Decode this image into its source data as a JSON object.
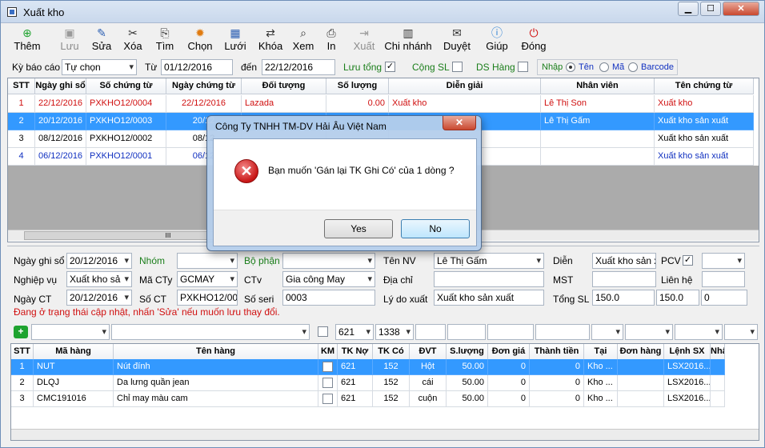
{
  "window": {
    "title": "Xuất kho",
    "min": "▁",
    "max": "☐",
    "close": "✕"
  },
  "toolbar": [
    {
      "label": "Thêm",
      "icon": "plus-icon",
      "enabled": true
    },
    {
      "label": "Lưu",
      "icon": "save-icon",
      "enabled": false
    },
    {
      "label": "Sửa",
      "icon": "edit-icon",
      "enabled": true
    },
    {
      "label": "Xóa",
      "icon": "delete-icon",
      "enabled": true
    },
    {
      "label": "Tìm",
      "icon": "find-icon",
      "enabled": true
    },
    {
      "label": "Chọn",
      "icon": "choose-icon",
      "enabled": true
    },
    {
      "label": "Lưới",
      "icon": "grid-icon",
      "enabled": true
    },
    {
      "label": "Khóa",
      "icon": "lock-icon",
      "enabled": true
    },
    {
      "label": "Xem",
      "icon": "view-icon",
      "enabled": true
    },
    {
      "label": "In",
      "icon": "print-icon",
      "enabled": true
    },
    {
      "label": "Xuất",
      "icon": "export-icon",
      "enabled": false
    },
    {
      "label": "Chi nhánh",
      "icon": "branch-icon",
      "enabled": true
    },
    {
      "label": "Duyệt",
      "icon": "approve-icon",
      "enabled": true
    },
    {
      "label": "Giúp",
      "icon": "help-icon",
      "enabled": true
    },
    {
      "label": "Đóng",
      "icon": "power-icon",
      "enabled": true
    }
  ],
  "filter": {
    "ky_bao_cao_label": "Kỳ báo cáo",
    "ky_bao_cao": "Tự chọn",
    "tu_label": "Từ",
    "tu": "01/12/2016",
    "den_label": "đến",
    "den": "22/12/2016",
    "luu_tong": "Lưu tổng",
    "cong_sl": "Cộng SL",
    "ds_hang": "DS Hàng",
    "nhap": "Nhập",
    "ten": "Tên",
    "ma": "Mã",
    "barcode": "Barcode"
  },
  "master": {
    "headers": [
      "STT",
      "Ngày ghi sổ",
      "Số chứng từ",
      "Ngày chứng từ",
      "Đối tượng",
      "Số lượng",
      "Diễn giải",
      "Nhân viên",
      "Tên chứng từ"
    ],
    "rows": [
      {
        "stt": "1",
        "ngay": "22/12/2016",
        "so": "PXKHO12/0004",
        "ngayct": "22/12/2016",
        "doi_tuong": "Lazada",
        "sl": "0.00",
        "dien_giai": "Xuất kho",
        "nv": "Lê Thị Son",
        "ten_ct": "Xuất kho"
      },
      {
        "stt": "2",
        "ngay": "20/12/2016",
        "so": "PXKHO12/0003",
        "ngayct": "20/12",
        "doi_tuong": "",
        "sl": "",
        "dien_giai": "",
        "nv": "Lê Thị Gấm",
        "ten_ct": "Xuất kho sản xuất"
      },
      {
        "stt": "3",
        "ngay": "08/12/2016",
        "so": "PXKHO12/0002",
        "ngayct": "08/12",
        "doi_tuong": "",
        "sl": "",
        "dien_giai": "",
        "nv": "",
        "ten_ct": "Xuất kho sản xuất"
      },
      {
        "stt": "4",
        "ngay": "06/12/2016",
        "so": "PXKHO12/0001",
        "ngayct": "06/12",
        "doi_tuong": "",
        "sl": "",
        "dien_giai": "",
        "nv": "",
        "ten_ct": "Xuất kho sản xuất"
      }
    ],
    "scroll": "III"
  },
  "form": {
    "ngay_ghi_so_label": "Ngày ghi sổ",
    "ngay_ghi_so": "20/12/2016",
    "nhom_label": "Nhóm",
    "bo_phan_label": "Bộ phận",
    "ten_nv_label": "Tên NV",
    "ten_nv": "Lê Thị Gấm",
    "dien_label": "Diễn",
    "dien": "Xuất kho sản xi",
    "pcv_label": "PCV",
    "nghiep_vu_label": "Nghiệp vụ",
    "nghiep_vu": "Xuất kho sả",
    "ma_cty_label": "Mã CTy",
    "ma_cty": "GCMAY",
    "ctv_label": "CTv",
    "ctv": "Gia công May",
    "dia_chi_label": "Địa chỉ",
    "mst_label": "MST",
    "lien_he_label": "Liên hệ",
    "ngay_ct_label": "Ngày CT",
    "ngay_ct": "20/12/2016",
    "so_ct_label": "Số CT",
    "so_ct": "PXKHO12/000",
    "so_seri_label": "Số seri",
    "so_seri": "0003",
    "ly_do_label": "Lý do xuất",
    "ly_do": "Xuất kho sản xuất",
    "tong_sl_label": "Tổng SL",
    "tong_sl": "150.0",
    "tong_sl2": "150.0",
    "tong_3": "0",
    "warning": "Đang ở trạng thái cập nhật, nhấn 'Sửa' nếu muốn lưu thay đổi."
  },
  "detail_filter": {
    "tk1": "621",
    "tk2": "1338"
  },
  "detail": {
    "headers": [
      "STT",
      "Mã hàng",
      "Tên hàng",
      "KM",
      "TK Nợ",
      "TK Có",
      "ĐVT",
      "S.lượng",
      "Đơn giá",
      "Thành tiền",
      "Tại",
      "Đơn hàng",
      "Lệnh SX",
      "Nhân"
    ],
    "rows": [
      {
        "stt": "1",
        "ma": "NUT",
        "ten": "Nút đính",
        "no": "621",
        "co": "152",
        "dvt": "Hột",
        "sl": "50.00",
        "dg": "0",
        "tt": "0",
        "tai": "Kho ...",
        "dh": "",
        "lsx": "LSX2016..."
      },
      {
        "stt": "2",
        "ma": "DLQJ",
        "ten": "Da lưng quần jean",
        "no": "621",
        "co": "152",
        "dvt": "cái",
        "sl": "50.00",
        "dg": "0",
        "tt": "0",
        "tai": "Kho ...",
        "dh": "",
        "lsx": "LSX2016..."
      },
      {
        "stt": "3",
        "ma": "CMC191016",
        "ten": "Chỉ may màu cam",
        "no": "621",
        "co": "152",
        "dvt": "cuộn",
        "sl": "50.00",
        "dg": "0",
        "tt": "0",
        "tai": "Kho ...",
        "dh": "",
        "lsx": "LSX2016..."
      }
    ]
  },
  "dialog": {
    "title": "Công Ty TNHH TM-DV Hải Âu Việt Nam",
    "message": "Bạn muốn 'Gán lại TK Ghi Có' của 1 dòng ?",
    "yes": "Yes",
    "no": "No",
    "close": "✕",
    "icon": "error-icon"
  }
}
